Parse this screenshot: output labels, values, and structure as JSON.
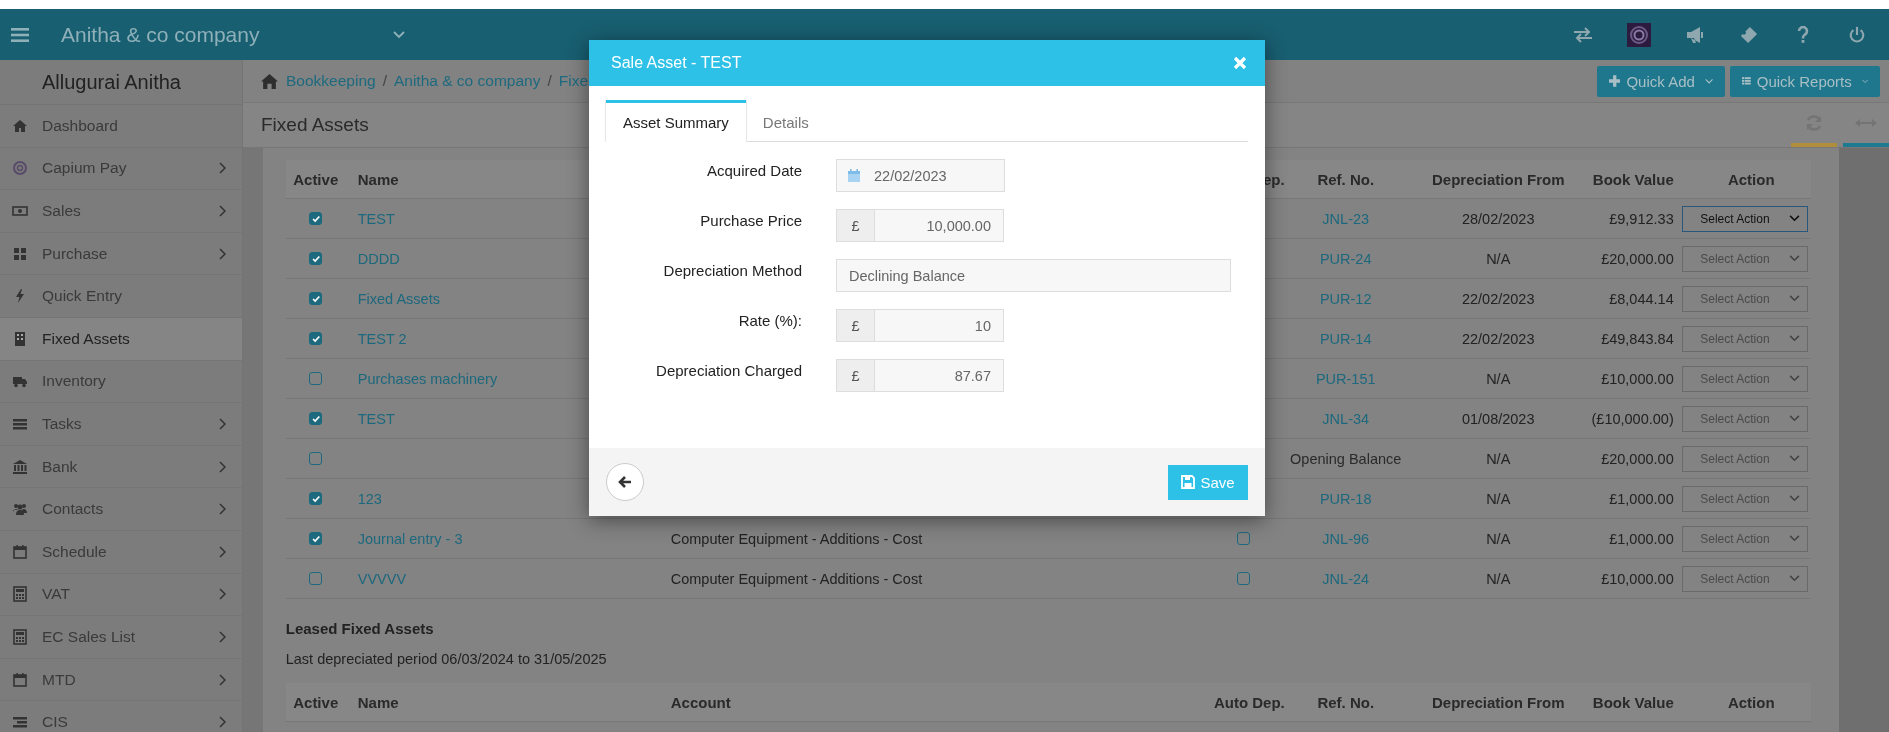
{
  "topbar": {
    "company": "Anitha & co company"
  },
  "sidebar": {
    "user": "Allugurai Anitha",
    "items": [
      {
        "label": "Dashboard",
        "selected": false,
        "expandable": false
      },
      {
        "label": "Capium Pay",
        "selected": false,
        "expandable": true
      },
      {
        "label": "Sales",
        "selected": false,
        "expandable": true
      },
      {
        "label": "Purchase",
        "selected": false,
        "expandable": true
      },
      {
        "label": "Quick Entry",
        "selected": false,
        "expandable": false
      },
      {
        "label": "Fixed Assets",
        "selected": true,
        "expandable": false
      },
      {
        "label": "Inventory",
        "selected": false,
        "expandable": false
      },
      {
        "label": "Tasks",
        "selected": false,
        "expandable": true
      },
      {
        "label": "Bank",
        "selected": false,
        "expandable": true
      },
      {
        "label": "Contacts",
        "selected": false,
        "expandable": true
      },
      {
        "label": "Schedule",
        "selected": false,
        "expandable": true
      },
      {
        "label": "VAT",
        "selected": false,
        "expandable": true
      },
      {
        "label": "EC Sales List",
        "selected": false,
        "expandable": true
      },
      {
        "label": "MTD",
        "selected": false,
        "expandable": true
      },
      {
        "label": "CIS",
        "selected": false,
        "expandable": true
      }
    ]
  },
  "breadcrumb": {
    "separator": "/",
    "items": [
      "Bookkeeping",
      "Anitha & co company",
      "Fixe"
    ]
  },
  "quick_buttons": [
    "Quick Add",
    "Quick Reports"
  ],
  "page_title": "Fixed Assets",
  "table": {
    "columns": {
      "active": "Active",
      "name": "Name",
      "auto_dep": "ep.",
      "ref": "Ref. No.",
      "dep_from": "Depreciation From",
      "book_value": "Book Value",
      "action": "Action"
    },
    "rows": [
      {
        "active": true,
        "name": "TEST",
        "ref": {
          "text": "JNL-23",
          "link": true
        },
        "dep_from": "28/02/2023",
        "book_value": "£9,912.33",
        "action": {
          "text": "Select Action",
          "focused": true
        }
      },
      {
        "active": true,
        "name": "DDDD",
        "ref": {
          "text": "PUR-24",
          "link": true
        },
        "dep_from": "N/A",
        "book_value": "£20,000.00",
        "action": {
          "text": "Select Action",
          "focused": false
        }
      },
      {
        "active": true,
        "name": "Fixed Assets",
        "ref": {
          "text": "PUR-12",
          "link": true
        },
        "dep_from": "22/02/2023",
        "book_value": "£8,044.14",
        "action": {
          "text": "Select Action",
          "focused": false
        }
      },
      {
        "active": true,
        "name": "TEST 2",
        "ref": {
          "text": "PUR-14",
          "link": true
        },
        "dep_from": "22/02/2023",
        "book_value": "£49,843.84",
        "action": {
          "text": "Select Action",
          "focused": false
        }
      },
      {
        "active": false,
        "name": "Purchases machinery",
        "ref": {
          "text": "PUR-151",
          "link": true
        },
        "dep_from": "N/A",
        "book_value": "£10,000.00",
        "action": {
          "text": "Select Action",
          "focused": false
        }
      },
      {
        "active": true,
        "name": "TEST",
        "ref": {
          "text": "JNL-34",
          "link": true
        },
        "dep_from": "01/08/2023",
        "book_value": "(£10,000.00)",
        "action": {
          "text": "Select Action",
          "focused": false
        }
      },
      {
        "active": false,
        "ref": {
          "text": "Opening Balance",
          "link": false
        },
        "dep_from": "N/A",
        "book_value": "£20,000.00",
        "action": {
          "text": "Select Action",
          "focused": false
        }
      },
      {
        "active": true,
        "name": "123",
        "ref": {
          "text": "PUR-18",
          "link": true
        },
        "dep_from": "N/A",
        "book_value": "£1,000.00",
        "action": {
          "text": "Select Action",
          "focused": false
        }
      },
      {
        "active": true,
        "name": "Journal entry - 3",
        "account": "Computer Equipment - Additions - Cost",
        "auto_dep": false,
        "ref": {
          "text": "JNL-96",
          "link": true
        },
        "dep_from": "N/A",
        "book_value": "£1,000.00",
        "action": {
          "text": "Select Action",
          "focused": false
        }
      },
      {
        "active": false,
        "name": "VVVVV",
        "account": "Computer Equipment - Additions - Cost",
        "auto_dep": false,
        "ref": {
          "text": "JNL-24",
          "link": true
        },
        "dep_from": "N/A",
        "book_value": "£10,000.00",
        "action": {
          "text": "Select Action",
          "focused": false
        }
      }
    ]
  },
  "leased": {
    "title": "Leased Fixed Assets",
    "period": "Last depreciated period 06/03/2024 to 31/05/2025",
    "columns": {
      "active": "Active",
      "name": "Name",
      "account": "Account",
      "auto_dep": "Auto Dep.",
      "ref": "Ref. No.",
      "dep_from": "Depreciation From",
      "book_value": "Book Value",
      "action": "Action"
    }
  },
  "modal": {
    "title": "Sale Asset - TEST",
    "tabs": [
      {
        "label": "Asset Summary",
        "selected": true
      },
      {
        "label": "Details",
        "selected": false
      }
    ],
    "fields": [
      {
        "label": "Acquired Date",
        "kind": "date",
        "value": "22/02/2023"
      },
      {
        "label": "Purchase Price",
        "kind": "currency",
        "prefix": "£",
        "value": "10,000.00"
      },
      {
        "label": "Depreciation Method",
        "kind": "text",
        "value": "Declining Balance"
      },
      {
        "label": "Rate (%):",
        "kind": "currency",
        "prefix": "£",
        "value": "10"
      },
      {
        "label": "Depreciation Charged",
        "kind": "currency",
        "prefix": "£",
        "value": "87.67"
      }
    ],
    "save": "Save"
  }
}
